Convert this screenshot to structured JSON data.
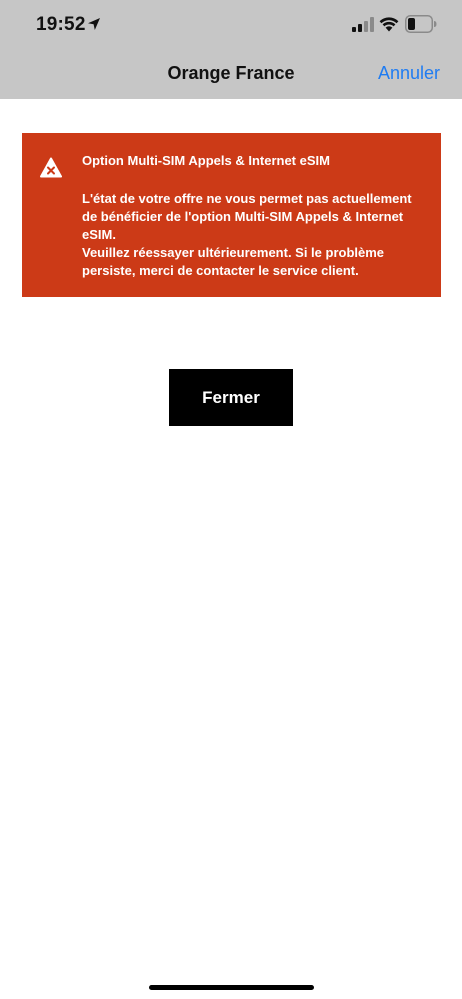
{
  "status_bar": {
    "time": "19:52",
    "icons": [
      "location-arrow-icon",
      "cellular-signal-icon",
      "wifi-icon",
      "battery-icon"
    ]
  },
  "nav": {
    "title": "Orange France",
    "cancel_label": "Annuler"
  },
  "alert": {
    "icon": "error-warning-icon",
    "title": "Option Multi-SIM Appels & Internet eSIM",
    "message_line1": "L'état de votre offre ne vous permet pas actuellement de bénéficier de l'option Multi-SIM Appels & Internet eSIM.",
    "message_line2": "Veuillez réessayer ultérieurement. Si le problème persiste, merci de contacter le service client."
  },
  "actions": {
    "close_label": "Fermer"
  },
  "colors": {
    "header_bg": "#c6c6c6",
    "alert_bg": "#cc3a17",
    "link_blue": "#1f7cf2",
    "button_bg": "#000000"
  }
}
